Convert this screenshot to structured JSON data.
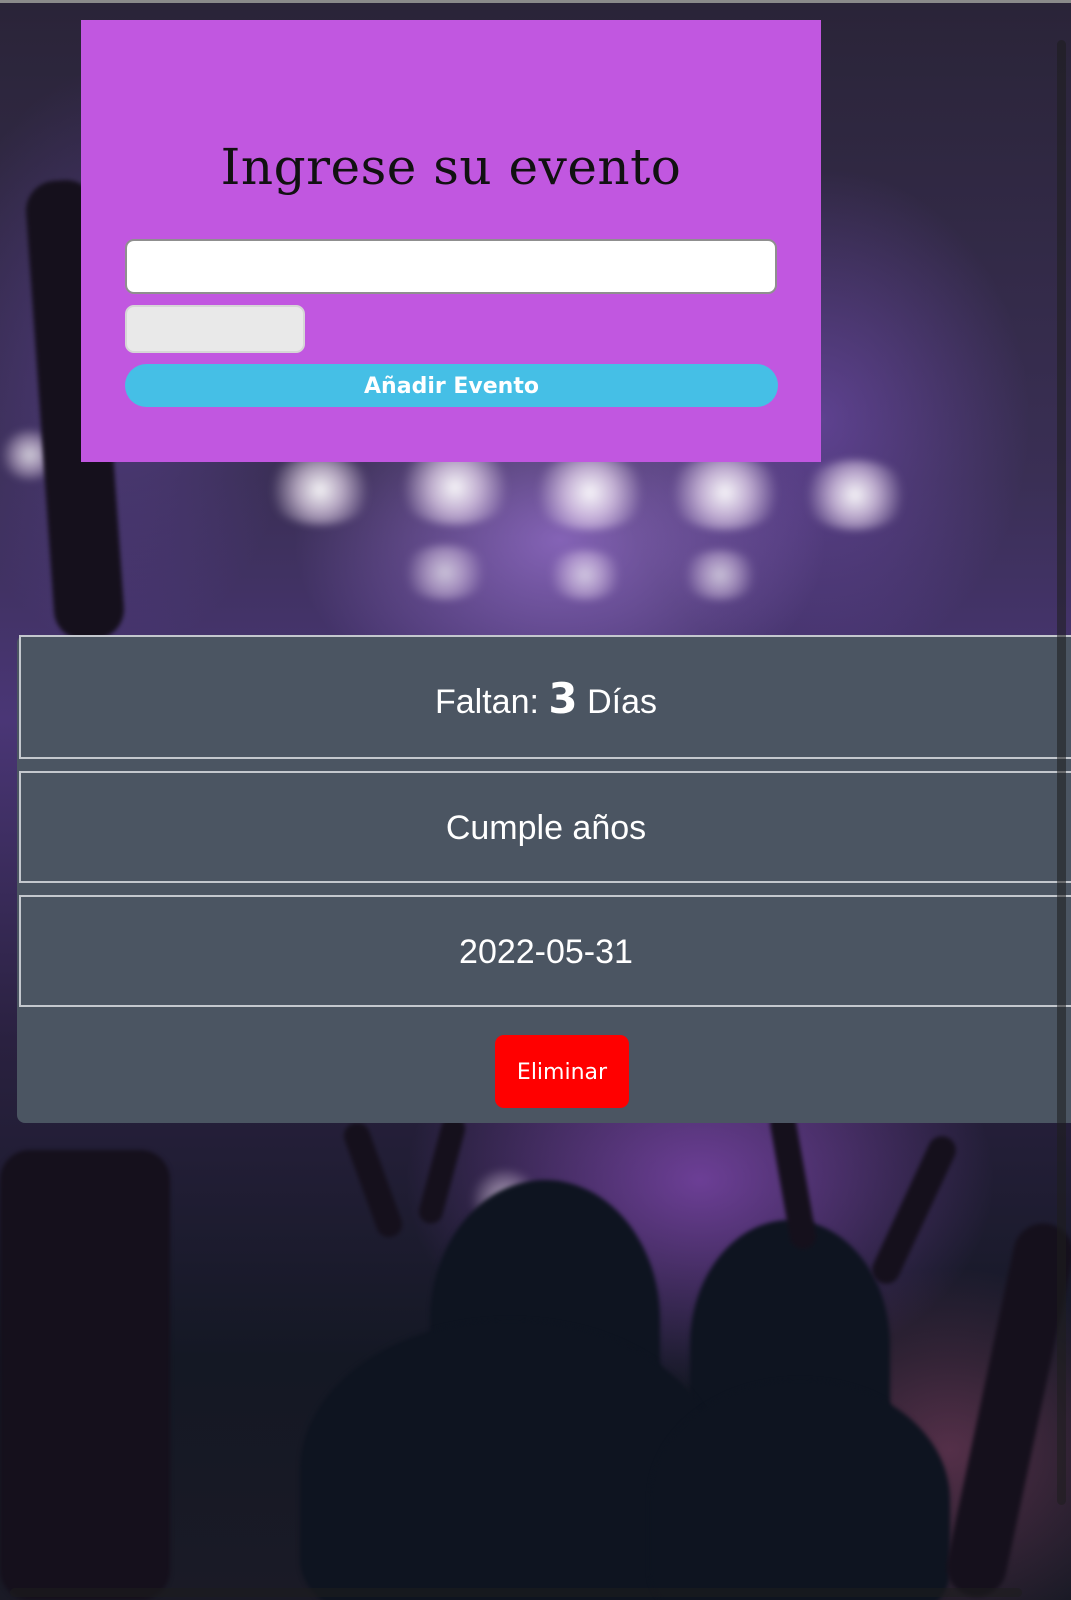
{
  "form": {
    "title": "Ingrese su evento",
    "event_input_value": "",
    "date_input_value": "",
    "add_button_label": "Añadir Evento",
    "background_color": "#c157e0",
    "button_color": "#45bfe6"
  },
  "event": {
    "countdown_prefix": "Faltan:",
    "days_remaining": "3",
    "countdown_suffix": "Días",
    "name": "Cumple años",
    "date": "2022-05-31",
    "delete_button_label": "Eliminar",
    "card_color": "#4b5562",
    "delete_color": "#ff0000"
  }
}
